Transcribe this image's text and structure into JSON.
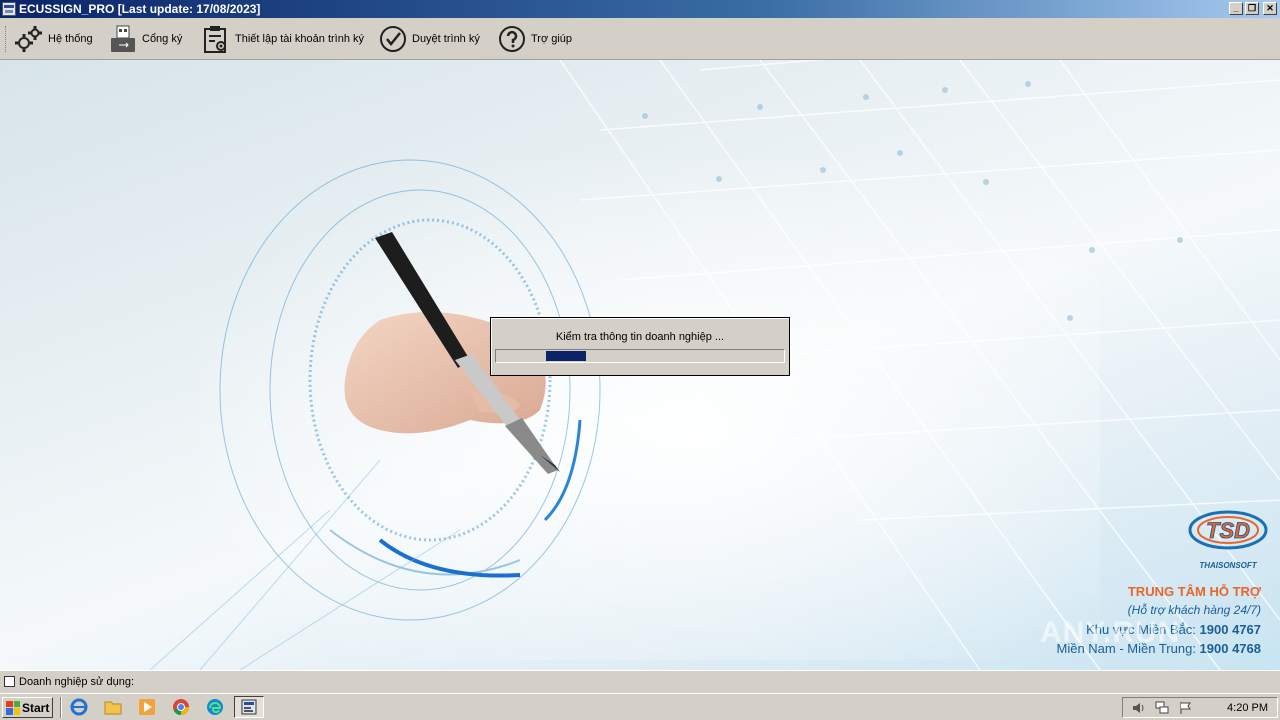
{
  "window": {
    "title": "ECUSSIGN_PRO [Last update: 17/08/2023]",
    "controls": {
      "minimize": "_",
      "restore": "❐",
      "close": "✕"
    }
  },
  "toolbar": {
    "items": [
      {
        "label": "Hệ thống",
        "icon": "gears-icon"
      },
      {
        "label": "Cổng ký",
        "icon": "usb-token-icon"
      },
      {
        "label": "Thiết lập tài khoản trình ký",
        "icon": "clipboard-settings-icon"
      },
      {
        "label": "Duyệt trình ký",
        "icon": "check-circle-icon"
      },
      {
        "label": "Trợ giúp",
        "icon": "question-circle-icon"
      }
    ]
  },
  "progress_dialog": {
    "message": "Kiểm tra thông tin doanh nghiệp ...",
    "progress_fraction": 0.14,
    "colors": {
      "fill": "#0a246a"
    }
  },
  "branding": {
    "logo_text": "TSD",
    "logo_subtext": "THAISONSOFT",
    "support_title": "TRUNG TÂM HỖ TRỢ",
    "support_subtitle": "(Hỗ trợ khách hàng 24/7)",
    "north_label": "Khu vực Miền Bắc: ",
    "north_phone": "1900 4767",
    "south_label": "Miền Nam - Miền Trung: ",
    "south_phone": "1900 4768",
    "colors": {
      "title": "#e8662a",
      "phones": "#1a5e9a"
    },
    "watermark": "ANY.RUN"
  },
  "statusbar": {
    "label": "Doanh nghiệp sử dụng:"
  },
  "taskbar": {
    "start_label": "Start",
    "quicklaunch": [
      "ie-icon",
      "folder-icon",
      "media-player-icon",
      "chrome-icon",
      "edge-icon",
      "ecussign-task-icon"
    ],
    "clock": "4:20 PM",
    "tray_icons": [
      "speaker-icon",
      "network-icon",
      "flag-icon"
    ]
  }
}
